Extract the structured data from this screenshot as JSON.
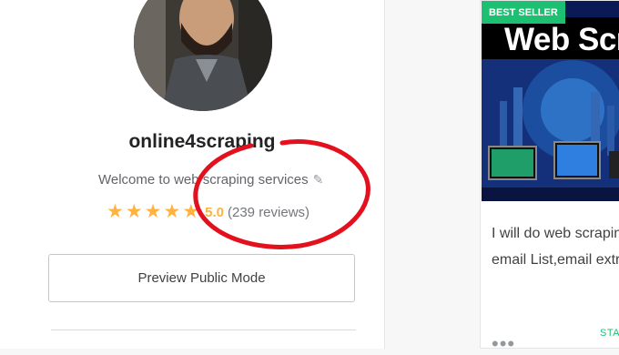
{
  "profile": {
    "username": "online4scraping",
    "tagline": "Welcome to web scraping services",
    "stars_filled": 5,
    "rating": "5.0",
    "reviews": "(239 reviews)",
    "preview_button": "Preview Public Mode"
  },
  "gig": {
    "badge": "BEST SELLER",
    "banner_title": "Web Scrap",
    "description_line1": "I will do web scraping",
    "description_line2": "email List,email extrac",
    "starting_label": "STAR",
    "more_icon": "more-dots-icon"
  },
  "icons": {
    "pencil": "pencil-icon",
    "star": "star-icon"
  },
  "colors": {
    "accent_green": "#1dbf73",
    "star": "#ffb33e",
    "annotation_red": "#e3101e"
  }
}
